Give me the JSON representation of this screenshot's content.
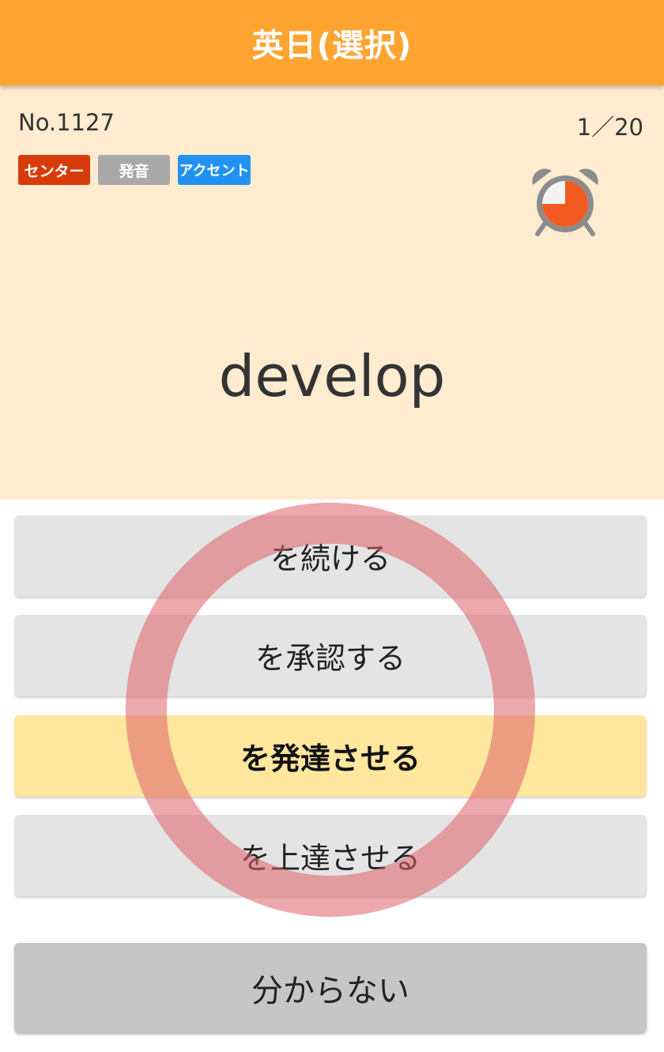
{
  "header": {
    "title": "英日(選択)"
  },
  "card": {
    "number": "No.1127",
    "progress": "1／20",
    "tags": [
      "センター",
      "発音",
      "アクセント"
    ],
    "timer_remaining_fraction": 0.75,
    "word": "develop"
  },
  "choices": [
    {
      "label": "を続ける",
      "selected": false
    },
    {
      "label": "を承認する",
      "selected": false
    },
    {
      "label": "を発達させる",
      "selected": true
    },
    {
      "label": "を上達させる",
      "selected": false
    }
  ],
  "dont_know_label": "分からない",
  "feedback": {
    "result": "correct-circle-icon"
  },
  "colors": {
    "header": "#ffa431",
    "card_bg": "#ffebd0",
    "selected_choice": "#ffe79e",
    "tag_center": "#d93a0a",
    "tag_pron": "#a9a9a9",
    "tag_accent": "#2192f2",
    "correct_mark": "#dd6068"
  }
}
